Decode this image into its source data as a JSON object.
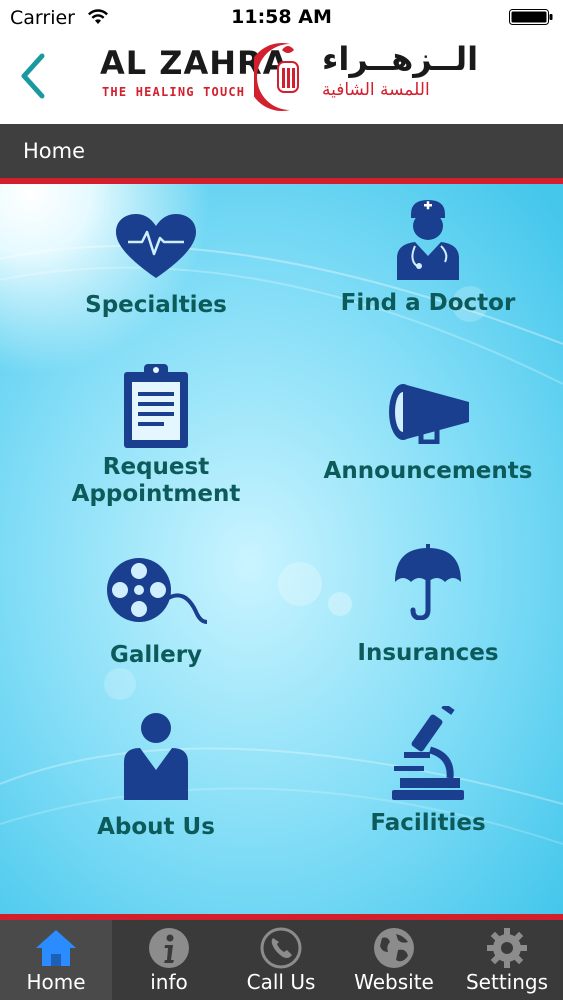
{
  "status_bar": {
    "carrier": "Carrier",
    "time": "11:58 AM"
  },
  "header": {
    "logo_en": "AL ZAHRA",
    "logo_tagline_en": "THE HEALING TOUCH",
    "logo_ar": "الــزهــراء",
    "logo_tagline_ar": "اللمسة الشافية"
  },
  "breadcrumb": {
    "label": "Home"
  },
  "menu": {
    "specialties": "Specialties",
    "find_doctor": "Find a Doctor",
    "request_line1": "Request",
    "request_line2": "Appointment",
    "announcements": "Announcements",
    "gallery": "Gallery",
    "insurances": "Insurances",
    "about": "About Us",
    "facilities": "Facilities"
  },
  "tabs": {
    "home": "Home",
    "info": "info",
    "call": "Call Us",
    "website": "Website",
    "settings": "Settings"
  },
  "colors": {
    "accent_red": "#d21f2b",
    "icon_blue": "#1b3f8f",
    "label_teal": "#0d5a5a",
    "tab_active_blue": "#2a8cff"
  }
}
